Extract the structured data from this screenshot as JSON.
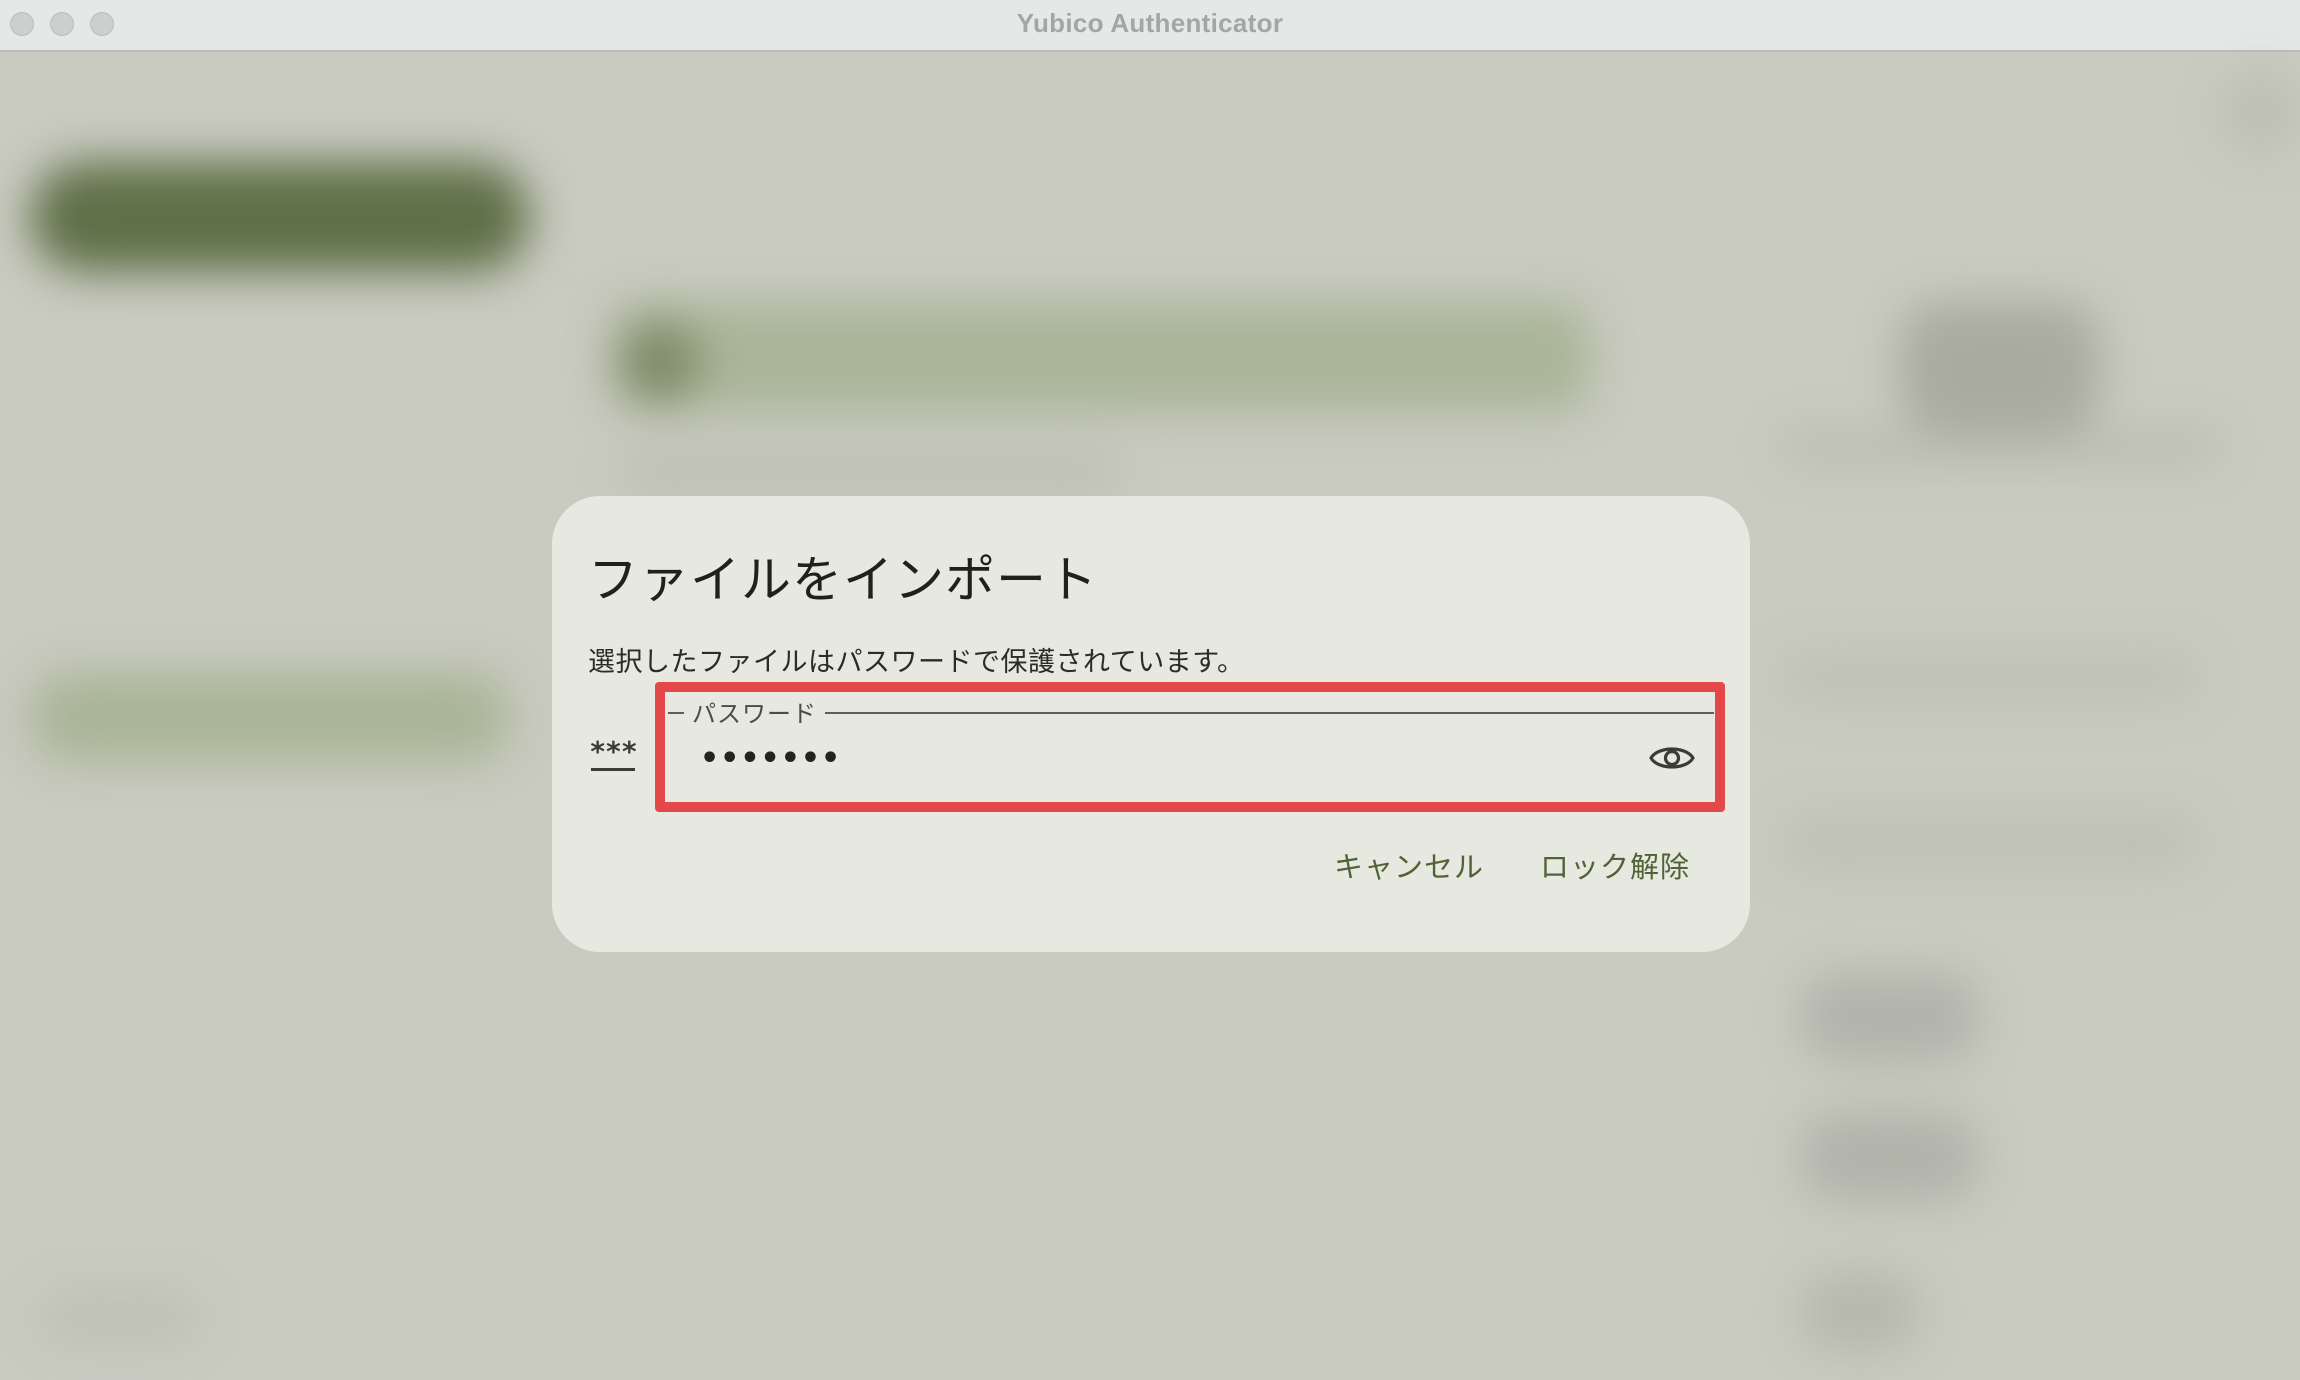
{
  "window": {
    "title": "Yubico Authenticator"
  },
  "dialog": {
    "title": "ファイルをインポート",
    "message": "選択したファイルはパスワードで保護されています。",
    "prefix_icon": "password-icon",
    "password_field": {
      "label": "パスワード",
      "value": "•••••••",
      "visibility_icon": "eye-icon"
    },
    "buttons": {
      "cancel": "キャンセル",
      "unlock": "ロック解除"
    }
  },
  "colors": {
    "accent": "#4f6336",
    "highlight": "#e5484a",
    "dialog_bg": "#e7e8df",
    "scrim": "#c9cac0"
  }
}
